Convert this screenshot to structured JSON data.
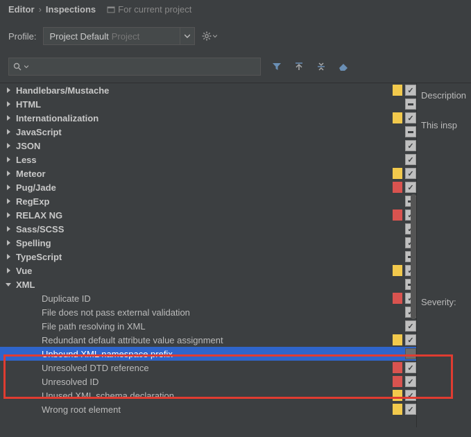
{
  "breadcrumb": {
    "item1": "Editor",
    "item2": "Inspections",
    "project_hint": "For current project"
  },
  "profile": {
    "label": "Profile:",
    "name": "Project Default",
    "scope": "Project"
  },
  "search": {
    "value": ""
  },
  "side": {
    "description_label": "Description",
    "description_text": "This insp",
    "severity_label": "Severity:"
  },
  "tree": [
    {
      "label": "Handlebars/Mustache",
      "depth": 1,
      "expandable": true,
      "expanded": false,
      "bold": true,
      "sev": "yellow",
      "chk": "checked",
      "selected": false
    },
    {
      "label": "HTML",
      "depth": 1,
      "expandable": true,
      "expanded": false,
      "bold": true,
      "sev": "",
      "chk": "mixed",
      "selected": false
    },
    {
      "label": "Internationalization",
      "depth": 1,
      "expandable": true,
      "expanded": false,
      "bold": true,
      "sev": "yellow",
      "chk": "checked",
      "selected": false
    },
    {
      "label": "JavaScript",
      "depth": 1,
      "expandable": true,
      "expanded": false,
      "bold": true,
      "sev": "",
      "chk": "mixed",
      "selected": false
    },
    {
      "label": "JSON",
      "depth": 1,
      "expandable": true,
      "expanded": false,
      "bold": true,
      "sev": "",
      "chk": "checked",
      "selected": false
    },
    {
      "label": "Less",
      "depth": 1,
      "expandable": true,
      "expanded": false,
      "bold": true,
      "sev": "",
      "chk": "checked",
      "selected": false
    },
    {
      "label": "Meteor",
      "depth": 1,
      "expandable": true,
      "expanded": false,
      "bold": true,
      "sev": "yellow",
      "chk": "checked",
      "selected": false
    },
    {
      "label": "Pug/Jade",
      "depth": 1,
      "expandable": true,
      "expanded": false,
      "bold": true,
      "sev": "red",
      "chk": "checked",
      "selected": false
    },
    {
      "label": "RegExp",
      "depth": 1,
      "expandable": true,
      "expanded": false,
      "bold": true,
      "sev": "",
      "chk": "mixed",
      "selected": false
    },
    {
      "label": "RELAX NG",
      "depth": 1,
      "expandable": true,
      "expanded": false,
      "bold": true,
      "sev": "red",
      "chk": "checked",
      "selected": false
    },
    {
      "label": "Sass/SCSS",
      "depth": 1,
      "expandable": true,
      "expanded": false,
      "bold": true,
      "sev": "",
      "chk": "checked",
      "selected": false
    },
    {
      "label": "Spelling",
      "depth": 1,
      "expandable": true,
      "expanded": false,
      "bold": true,
      "sev": "",
      "chk": "checked",
      "selected": false
    },
    {
      "label": "TypeScript",
      "depth": 1,
      "expandable": true,
      "expanded": false,
      "bold": true,
      "sev": "",
      "chk": "mixed",
      "selected": false
    },
    {
      "label": "Vue",
      "depth": 1,
      "expandable": true,
      "expanded": false,
      "bold": true,
      "sev": "yellow",
      "chk": "checked",
      "selected": false
    },
    {
      "label": "XML",
      "depth": 1,
      "expandable": true,
      "expanded": true,
      "bold": true,
      "sev": "",
      "chk": "mixed",
      "selected": false,
      "xml": true
    },
    {
      "label": "Duplicate ID",
      "depth": 2,
      "expandable": false,
      "bold": false,
      "sev": "red",
      "chk": "checked",
      "selected": false
    },
    {
      "label": "File does not pass external validation",
      "depth": 2,
      "expandable": false,
      "bold": false,
      "sev": "",
      "chk": "checked",
      "selected": false
    },
    {
      "label": "File path resolving in XML",
      "depth": 2,
      "expandable": false,
      "bold": false,
      "sev": "",
      "chk": "checked",
      "selected": false
    },
    {
      "label": "Redundant default attribute value assignment",
      "depth": 2,
      "expandable": false,
      "bold": false,
      "sev": "yellow",
      "chk": "checked",
      "selected": false
    },
    {
      "label": "Unbound XML namespace prefix",
      "depth": 2,
      "expandable": false,
      "bold": false,
      "sev": "",
      "chk": "unchecked",
      "selected": true
    },
    {
      "label": "Unresolved DTD reference",
      "depth": 2,
      "expandable": false,
      "bold": false,
      "sev": "red",
      "chk": "checked",
      "selected": false
    },
    {
      "label": "Unresolved ID",
      "depth": 2,
      "expandable": false,
      "bold": false,
      "sev": "red",
      "chk": "checked",
      "selected": false
    },
    {
      "label": "Unused XML schema declaration",
      "depth": 2,
      "expandable": false,
      "bold": false,
      "sev": "yellow",
      "chk": "checked",
      "selected": false
    },
    {
      "label": "Wrong root element",
      "depth": 2,
      "expandable": false,
      "bold": false,
      "sev": "yellow",
      "chk": "checked",
      "selected": false
    }
  ]
}
